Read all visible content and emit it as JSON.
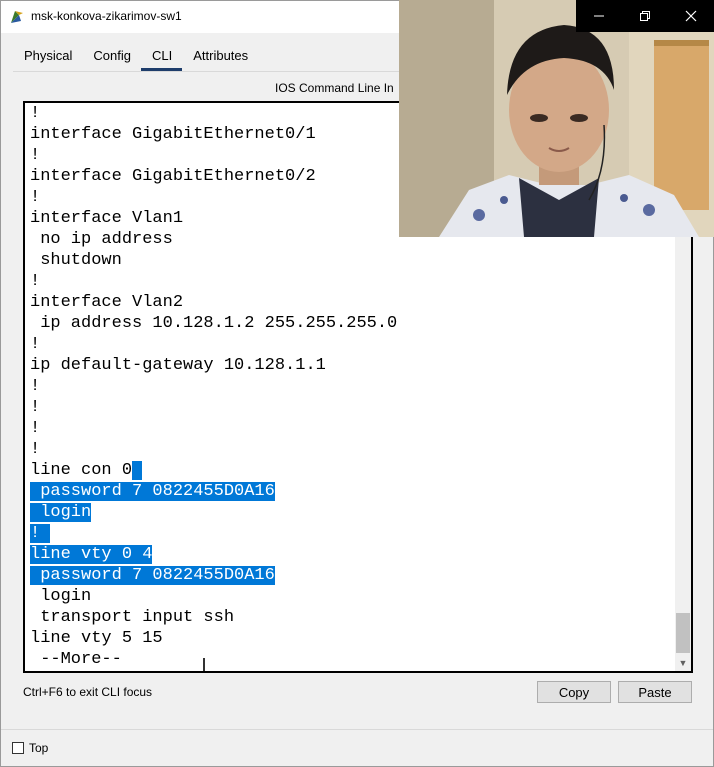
{
  "window": {
    "title": "msk-konkova-zikarimov-sw1",
    "controls": [
      "minimize-icon",
      "restore-icon",
      "close-icon"
    ]
  },
  "tabs": [
    {
      "label": "Physical",
      "active": false
    },
    {
      "label": "Config",
      "active": false
    },
    {
      "label": "CLI",
      "active": true
    },
    {
      "label": "Attributes",
      "active": false
    }
  ],
  "section_title": "IOS Command Line In",
  "terminal": {
    "lines": [
      {
        "text": "!",
        "hl": ""
      },
      {
        "text": "interface GigabitEthernet0/1",
        "hl": ""
      },
      {
        "text": "!",
        "hl": ""
      },
      {
        "text": "interface GigabitEthernet0/2",
        "hl": ""
      },
      {
        "text": "!",
        "hl": ""
      },
      {
        "text": "interface Vlan1",
        "hl": ""
      },
      {
        "text": " no ip address",
        "hl": ""
      },
      {
        "text": " shutdown",
        "hl": ""
      },
      {
        "text": "!",
        "hl": ""
      },
      {
        "text": "interface Vlan2",
        "hl": ""
      },
      {
        "text": " ip address 10.128.1.2 255.255.255.0",
        "hl": ""
      },
      {
        "text": "!",
        "hl": ""
      },
      {
        "text": "ip default-gateway 10.128.1.1",
        "hl": ""
      },
      {
        "text": "!",
        "hl": ""
      },
      {
        "text": "!",
        "hl": ""
      },
      {
        "text": "!",
        "hl": ""
      },
      {
        "text": "!",
        "hl": ""
      },
      {
        "text": "line con 0",
        "hl": " "
      },
      {
        "text": "",
        "hl": " password 7 0822455D0A16"
      },
      {
        "text": "",
        "hl": " login"
      },
      {
        "text": "",
        "hl": "! "
      },
      {
        "text": "",
        "hl": "line vty 0 4"
      },
      {
        "text": "",
        "hl": " password 7 0822455D0A16"
      },
      {
        "text": " login",
        "hl": ""
      },
      {
        "text": " transport input ssh",
        "hl": ""
      },
      {
        "text": "line vty 5 15",
        "hl": ""
      },
      {
        "text": " --More--",
        "hl": ""
      }
    ]
  },
  "footer": {
    "hint": "Ctrl+F6 to exit CLI focus",
    "copy_label": "Copy",
    "paste_label": "Paste",
    "top_label": "Top",
    "top_checked": false
  },
  "colors": {
    "selection": "#0078d7",
    "tab_underline": "#1e3d6b",
    "titlebar_controls_bg": "#000000"
  }
}
